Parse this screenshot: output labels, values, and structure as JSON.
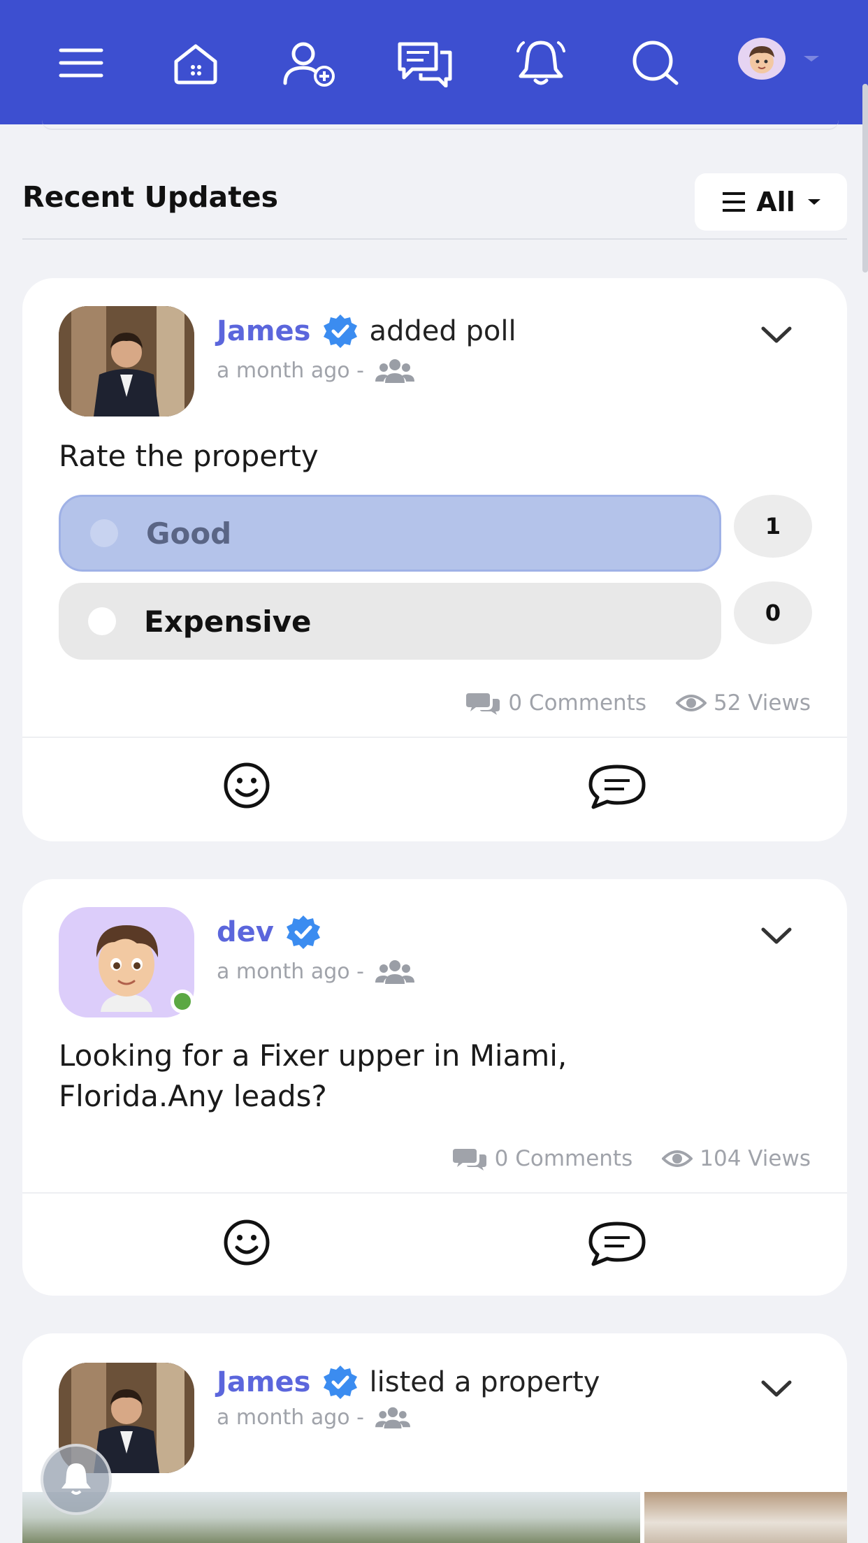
{
  "navbar": {
    "bg_color": "#3d4fd0",
    "icons": [
      "menu-icon",
      "home-icon",
      "add-user-icon",
      "messages-icon",
      "bell-icon",
      "search-icon"
    ]
  },
  "feed": {
    "section_title": "Recent Updates",
    "filter_label": "All"
  },
  "posts": [
    {
      "author": "James",
      "action": "added poll",
      "time": "a month ago -",
      "question": "Rate the property",
      "poll_options": [
        {
          "label": "Good",
          "count": "1",
          "selected": true
        },
        {
          "label": "Expensive",
          "count": "0",
          "selected": false
        }
      ],
      "comments": "0 Comments",
      "views": "52 Views"
    },
    {
      "author": "dev",
      "time": "a month ago -",
      "text": "Looking for a Fixer upper in Miami, Florida.Any leads?",
      "comments": "0 Comments",
      "views": "104 Views"
    },
    {
      "author": "James",
      "action": "listed a property",
      "time": "a month ago -"
    }
  ],
  "colors": {
    "accent": "#5b66dc",
    "verified": "#3b8cf0",
    "poll_selected": "#b4c3ea",
    "poll_unselected": "#e8e8e8",
    "online": "#5ba843"
  }
}
